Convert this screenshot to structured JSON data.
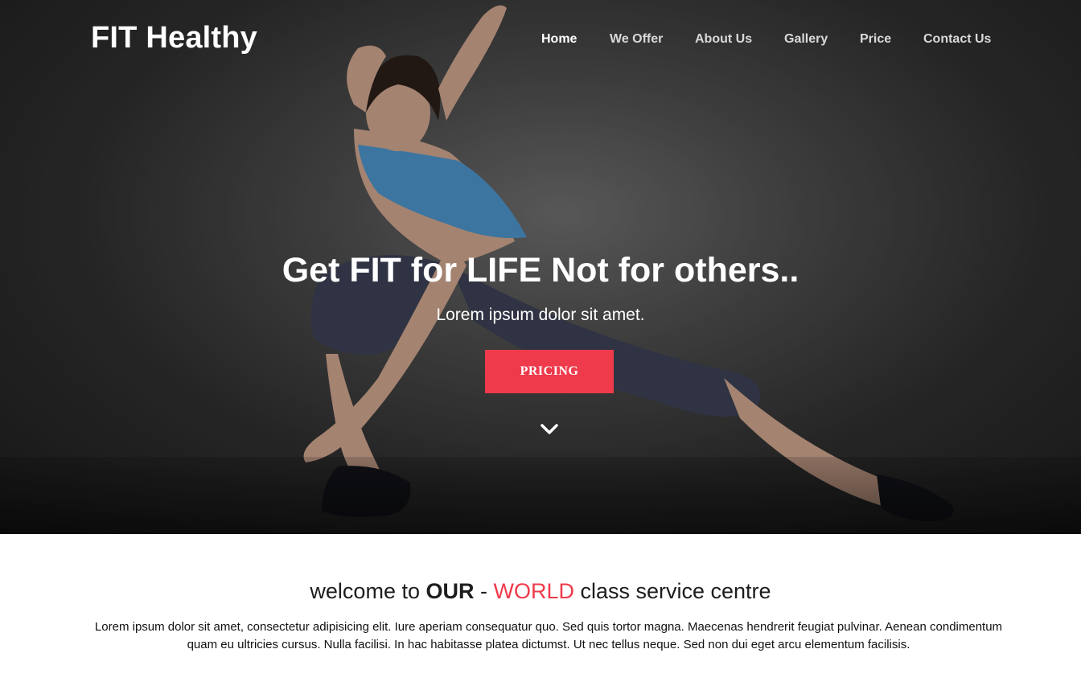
{
  "header": {
    "brand": "FIT Healthy",
    "nav": [
      {
        "label": "Home",
        "active": true
      },
      {
        "label": "We Offer",
        "active": false
      },
      {
        "label": "About Us",
        "active": false
      },
      {
        "label": "Gallery",
        "active": false
      },
      {
        "label": "Price",
        "active": false
      },
      {
        "label": "Contact Us",
        "active": false
      }
    ]
  },
  "hero": {
    "title": "Get FIT for LIFE Not for others..",
    "subtitle": "Lorem ipsum dolor sit amet.",
    "cta_label": "PRICING",
    "scroll_icon": "chevron-down-icon"
  },
  "welcome": {
    "part1": "welcome to ",
    "part2": "OUR",
    "part3": " - ",
    "part4": "WORLD",
    "part5": " class service centre",
    "body": "Lorem ipsum dolor sit amet, consectetur adipisicing elit. Iure aperiam consequatur quo. Sed quis tortor magna. Maecenas hendrerit feugiat pulvinar. Aenean condimentum quam eu ultricies cursus. Nulla facilisi. In hac habitasse platea dictumst. Ut nec tellus neque. Sed non dui eget arcu elementum facilisis."
  },
  "colors": {
    "accent": "#ef3a4b",
    "nav_inactive": "#d9d9d9",
    "text_dark": "#1d1d1d"
  }
}
